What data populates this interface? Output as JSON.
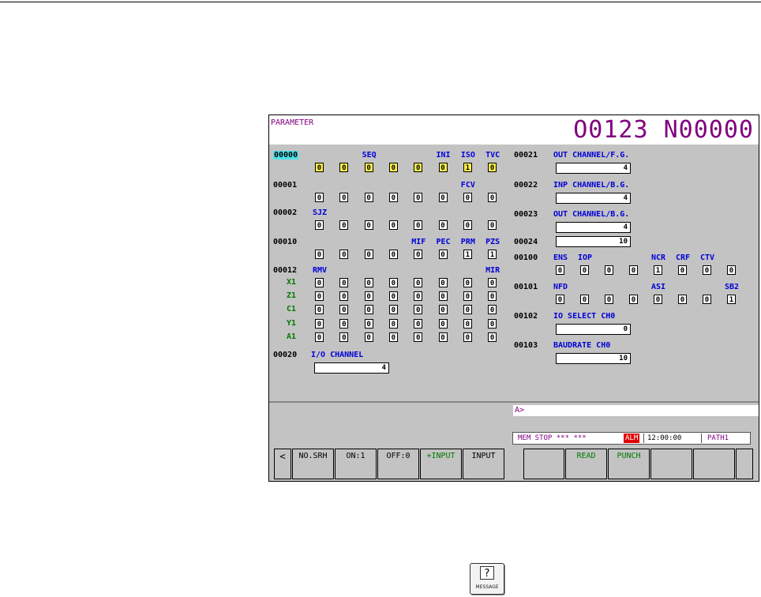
{
  "header": {
    "title": "PARAMETER",
    "program": "O0123 N00000"
  },
  "left_params": [
    {
      "number": "00000",
      "highlight": true,
      "names": [
        "",
        "",
        "SEQ",
        "",
        "",
        "INI",
        "ISO",
        "TVC"
      ],
      "rows": [
        {
          "axis": "",
          "bits": [
            "0",
            "0",
            "0",
            "0",
            "0",
            "0",
            "1",
            "0"
          ],
          "yellow": true
        }
      ]
    },
    {
      "number": "00001",
      "highlight": false,
      "names": [
        "",
        "",
        "",
        "",
        "",
        "",
        "FCV",
        ""
      ],
      "rows": [
        {
          "axis": "",
          "bits": [
            "0",
            "0",
            "0",
            "0",
            "0",
            "0",
            "0",
            "0"
          ],
          "yellow": false
        }
      ]
    },
    {
      "number": "00002",
      "highlight": false,
      "names": [
        "SJZ",
        "",
        "",
        "",
        "",
        "",
        "",
        ""
      ],
      "rows": [
        {
          "axis": "",
          "bits": [
            "0",
            "0",
            "0",
            "0",
            "0",
            "0",
            "0",
            "0"
          ],
          "yellow": false
        }
      ]
    },
    {
      "number": "00010",
      "highlight": false,
      "names": [
        "",
        "",
        "",
        "",
        "MIF",
        "PEC",
        "PRM",
        "PZS"
      ],
      "rows": [
        {
          "axis": "",
          "bits": [
            "0",
            "0",
            "0",
            "0",
            "0",
            "0",
            "1",
            "1"
          ],
          "yellow": false
        }
      ]
    },
    {
      "number": "00012",
      "highlight": false,
      "names": [
        "RMV",
        "",
        "",
        "",
        "",
        "",
        "",
        "MIR"
      ],
      "rows": [
        {
          "axis": "X1",
          "bits": [
            "0",
            "0",
            "0",
            "0",
            "0",
            "0",
            "0",
            "0"
          ],
          "yellow": false
        },
        {
          "axis": "Z1",
          "bits": [
            "0",
            "0",
            "0",
            "0",
            "0",
            "0",
            "0",
            "0"
          ],
          "yellow": false
        },
        {
          "axis": "C1",
          "bits": [
            "0",
            "0",
            "0",
            "0",
            "0",
            "0",
            "0",
            "0"
          ],
          "yellow": false
        },
        {
          "axis": "Y1",
          "bits": [
            "0",
            "0",
            "0",
            "0",
            "0",
            "0",
            "0",
            "0"
          ],
          "yellow": false
        },
        {
          "axis": "A1",
          "bits": [
            "0",
            "0",
            "0",
            "0",
            "0",
            "0",
            "0",
            "0"
          ],
          "yellow": false
        }
      ]
    }
  ],
  "io_channel": {
    "number": "00020",
    "name": "I/O CHANNEL",
    "value": "4"
  },
  "right_values": [
    {
      "number": "00021",
      "name": "OUT CHANNEL/F.G.",
      "value": "4"
    },
    {
      "number": "00022",
      "name": "INP CHANNEL/B.G.",
      "value": "4"
    },
    {
      "number": "00023",
      "name": "OUT CHANNEL/B.G.",
      "value": "4"
    },
    {
      "number": "00024",
      "name": "",
      "value": "10"
    }
  ],
  "right_bits": [
    {
      "number": "00100",
      "names": [
        "ENS",
        "IOP",
        "",
        "",
        "NCR",
        "CRF",
        "CTV",
        ""
      ],
      "bits": [
        "0",
        "0",
        "0",
        "0",
        "1",
        "0",
        "0",
        "0"
      ]
    },
    {
      "number": "00101",
      "names": [
        "NFD",
        "",
        "",
        "",
        "ASI",
        "",
        "",
        "SB2"
      ],
      "bits": [
        "0",
        "0",
        "0",
        "0",
        "0",
        "0",
        "0",
        "1"
      ]
    }
  ],
  "right_values2": [
    {
      "number": "00102",
      "name": "IO SELECT CH0",
      "value": "0"
    },
    {
      "number": "00103",
      "name": "BAUDRATE CH0",
      "value": "10"
    }
  ],
  "prompt": "A>",
  "status": {
    "mode": "MEM  STOP *** ***",
    "alarm": "ALM",
    "time": "12:00:00",
    "path": "PATH1"
  },
  "softkeys": [
    {
      "label": "<",
      "color": "#000000"
    },
    {
      "label": "NO.SRH",
      "color": "#000000"
    },
    {
      "label": "ON:1",
      "color": "#000000"
    },
    {
      "label": "OFF:0",
      "color": "#000000"
    },
    {
      "label": "+INPUT",
      "color": "#007a00"
    },
    {
      "label": "INPUT",
      "color": "#000000"
    },
    {
      "label": "",
      "color": "#000000"
    },
    {
      "label": "READ",
      "color": "#007a00"
    },
    {
      "label": "PUNCH",
      "color": "#007a00"
    },
    {
      "label": "",
      "color": "#000000"
    },
    {
      "label": "",
      "color": "#000000"
    },
    {
      "label": "",
      "color": "#000000"
    }
  ],
  "message_key": {
    "symbol": "?",
    "label": "MESSAGE"
  },
  "colors": {
    "title": "#800080",
    "bit_name": "#0000d8",
    "axis": "#007a00",
    "highlight": "#4ee0e8",
    "changed_bits": "#fff14a",
    "screen_bg": "#c3c3c3",
    "alarm": "#e00000"
  }
}
